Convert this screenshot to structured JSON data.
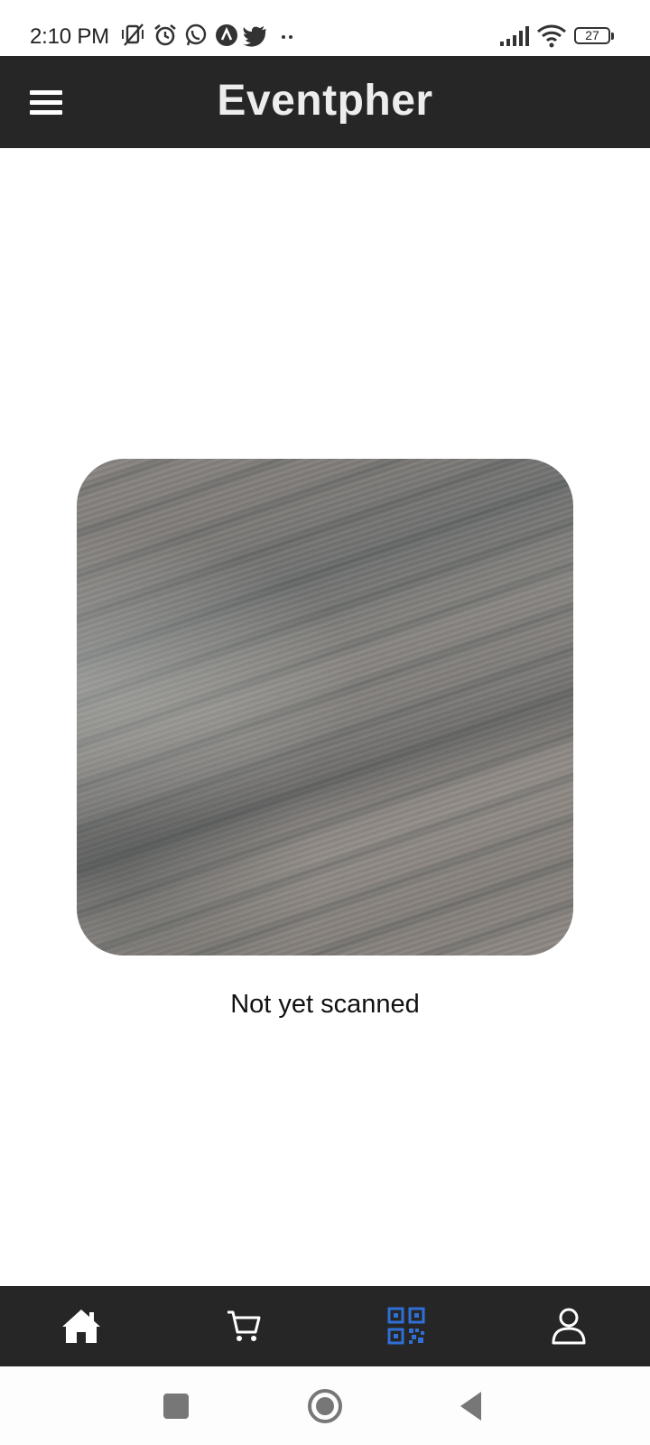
{
  "status_bar": {
    "time": "2:10 PM",
    "battery": "27",
    "left_icons": [
      "vibrate-off-icon",
      "alarm-icon",
      "whatsapp-icon",
      "app-icon",
      "twitter-icon",
      "more-dots-icon"
    ],
    "right_icons": [
      "signal-icon",
      "wifi-icon",
      "battery-icon"
    ]
  },
  "header": {
    "title": "Eventpher",
    "menu_icon": "hamburger-menu-icon",
    "background": "#262626"
  },
  "scanner": {
    "status_text": "Not yet scanned"
  },
  "bottom_nav": {
    "items": [
      {
        "icon": "home-icon",
        "active": false
      },
      {
        "icon": "cart-icon",
        "active": false
      },
      {
        "icon": "qr-code-icon",
        "active": true
      },
      {
        "icon": "profile-icon",
        "active": false
      }
    ],
    "active_color": "#2f6fd6",
    "inactive_color": "#ffffff"
  },
  "system_nav": {
    "buttons": [
      "recents-icon",
      "home-circle-icon",
      "back-icon"
    ]
  }
}
